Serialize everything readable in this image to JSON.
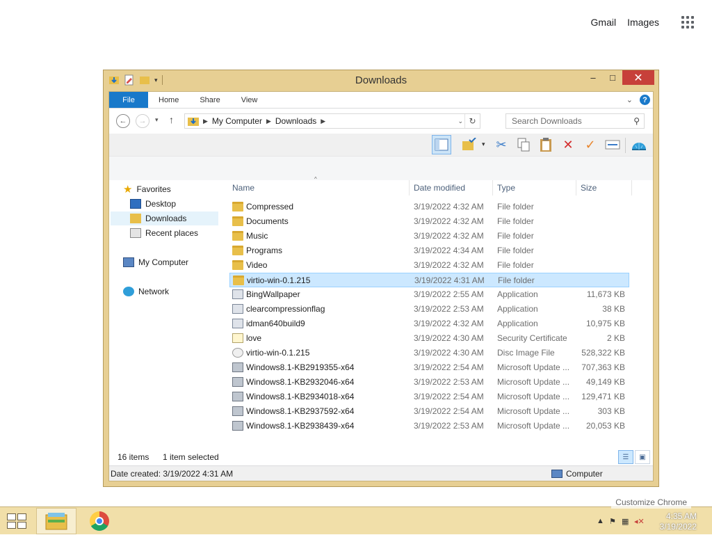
{
  "google_header": {
    "gmail": "Gmail",
    "images": "Images",
    "apps_icon": "apps-grid-icon"
  },
  "window": {
    "title": "Downloads",
    "caption": {
      "minimize": "‒",
      "maximize": "□",
      "close": "✕"
    }
  },
  "ribbon": {
    "tabs": [
      "File",
      "Home",
      "Share",
      "View"
    ],
    "help": "?"
  },
  "address": {
    "segments": [
      "My Computer",
      "Downloads"
    ],
    "search_placeholder": "Search Downloads"
  },
  "nav_pane": {
    "favorites": "Favorites",
    "desktop": "Desktop",
    "downloads": "Downloads",
    "recent": "Recent places",
    "computer": "My Computer",
    "network": "Network"
  },
  "columns": {
    "name": "Name",
    "date": "Date modified",
    "type": "Type",
    "size": "Size"
  },
  "files": [
    {
      "name": "Compressed",
      "date": "3/19/2022 4:32 AM",
      "type": "File folder",
      "size": "",
      "icon": "folder"
    },
    {
      "name": "Documents",
      "date": "3/19/2022 4:32 AM",
      "type": "File folder",
      "size": "",
      "icon": "folder"
    },
    {
      "name": "Music",
      "date": "3/19/2022 4:32 AM",
      "type": "File folder",
      "size": "",
      "icon": "folder"
    },
    {
      "name": "Programs",
      "date": "3/19/2022 4:34 AM",
      "type": "File folder",
      "size": "",
      "icon": "folder"
    },
    {
      "name": "Video",
      "date": "3/19/2022 4:32 AM",
      "type": "File folder",
      "size": "",
      "icon": "folder"
    },
    {
      "name": "virtio-win-0.1.215",
      "date": "3/19/2022 4:31 AM",
      "type": "File folder",
      "size": "",
      "icon": "folder",
      "selected": true
    },
    {
      "name": "BingWallpaper",
      "date": "3/19/2022 2:55 AM",
      "type": "Application",
      "size": "11,673 KB",
      "icon": "exe"
    },
    {
      "name": "clearcompressionflag",
      "date": "3/19/2022 2:53 AM",
      "type": "Application",
      "size": "38 KB",
      "icon": "exe"
    },
    {
      "name": "idman640build9",
      "date": "3/19/2022 4:32 AM",
      "type": "Application",
      "size": "10,975 KB",
      "icon": "exe"
    },
    {
      "name": "love",
      "date": "3/19/2022 4:30 AM",
      "type": "Security Certificate",
      "size": "2 KB",
      "icon": "cert"
    },
    {
      "name": "virtio-win-0.1.215",
      "date": "3/19/2022 4:30 AM",
      "type": "Disc Image File",
      "size": "528,322 KB",
      "icon": "iso"
    },
    {
      "name": "Windows8.1-KB2919355-x64",
      "date": "3/19/2022 2:54 AM",
      "type": "Microsoft Update ...",
      "size": "707,363 KB",
      "icon": "msu"
    },
    {
      "name": "Windows8.1-KB2932046-x64",
      "date": "3/19/2022 2:53 AM",
      "type": "Microsoft Update ...",
      "size": "49,149 KB",
      "icon": "msu"
    },
    {
      "name": "Windows8.1-KB2934018-x64",
      "date": "3/19/2022 2:54 AM",
      "type": "Microsoft Update ...",
      "size": "129,471 KB",
      "icon": "msu"
    },
    {
      "name": "Windows8.1-KB2937592-x64",
      "date": "3/19/2022 2:54 AM",
      "type": "Microsoft Update ...",
      "size": "303 KB",
      "icon": "msu"
    },
    {
      "name": "Windows8.1-KB2938439-x64",
      "date": "3/19/2022 2:53 AM",
      "type": "Microsoft Update ...",
      "size": "20,053 KB",
      "icon": "msu"
    }
  ],
  "status": {
    "count": "16 items",
    "selection": "1 item selected"
  },
  "details": {
    "created": "Date created: 3/19/2022 4:31 AM",
    "location": "Computer"
  },
  "taskbar": {
    "customize": "Customize Chrome",
    "time": "4:35 AM",
    "date": "3/19/2022"
  },
  "colors": {
    "window_frame": "#e7cf93",
    "file_tab": "#1979ca",
    "close": "#c7403a",
    "selection": "#cce8ff"
  }
}
